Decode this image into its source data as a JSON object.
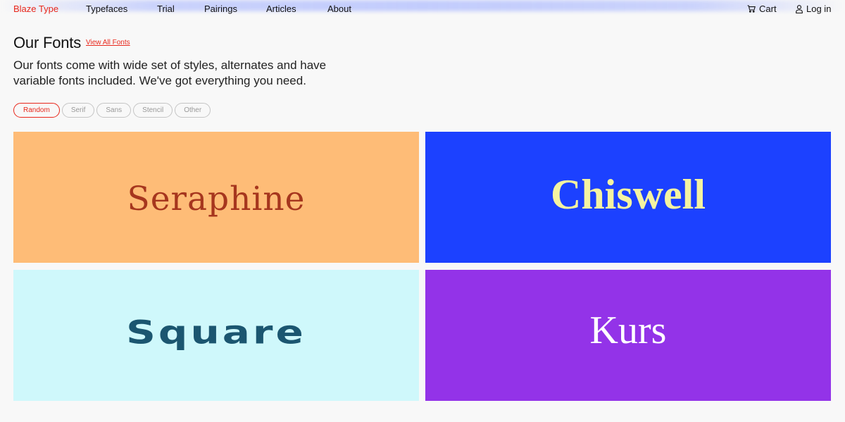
{
  "nav": {
    "brand": "Blaze Type",
    "items": [
      {
        "label": "Typefaces"
      },
      {
        "label": "Trial"
      },
      {
        "label": "Pairings"
      },
      {
        "label": "Articles"
      },
      {
        "label": "About"
      }
    ],
    "cart": "Cart",
    "login": "Log in"
  },
  "section": {
    "title": "Our Fonts",
    "view_all": "View All Fonts",
    "lead": "Our fonts come with wide set of styles, alternates and have variable fonts included. We've got everything you need."
  },
  "filters": [
    {
      "label": "Random",
      "active": true
    },
    {
      "label": "Serif"
    },
    {
      "label": "Sans"
    },
    {
      "label": "Stencil"
    },
    {
      "label": "Other"
    }
  ],
  "fonts": [
    {
      "name": "Seraphine",
      "bg": "#febc77",
      "color": "#a6361e"
    },
    {
      "name": "Chiswell",
      "bg": "#1c41ff",
      "color": "#f5f3a1"
    },
    {
      "name": "Square",
      "bg": "#cff8fb",
      "color": "#1b5670"
    },
    {
      "name": "Kurs",
      "bg": "#9333e8",
      "color": "#ffffff"
    }
  ],
  "icons": {
    "cart": "cart-icon",
    "user": "user-icon"
  },
  "colors": {
    "accent": "#e8271b"
  }
}
